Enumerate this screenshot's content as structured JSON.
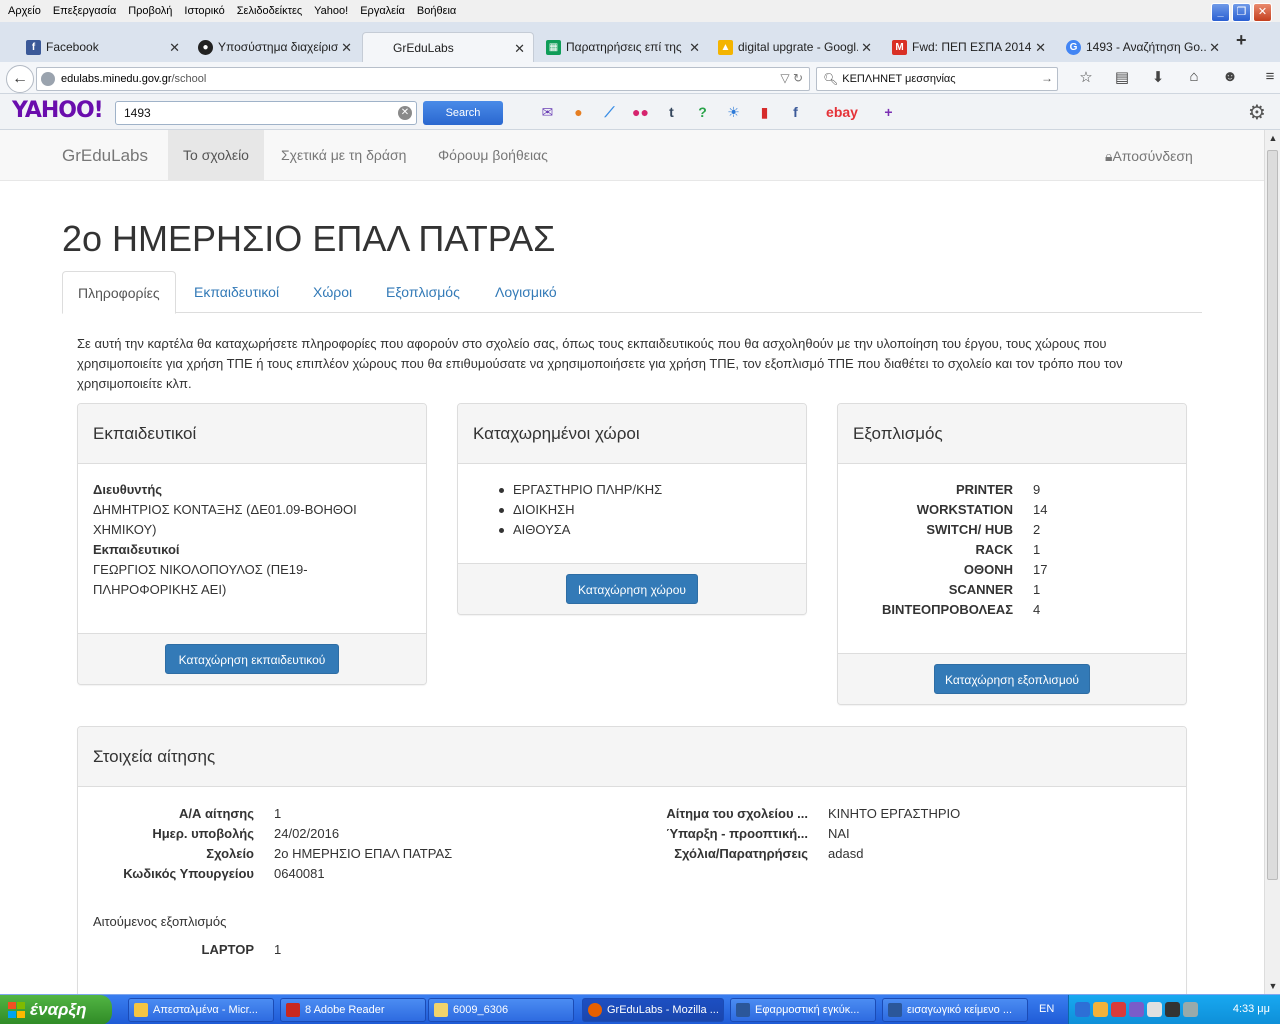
{
  "browser": {
    "menu": [
      "Αρχείο",
      "Επεξεργασία",
      "Προβολή",
      "Ιστορικό",
      "Σελιδοδείκτες",
      "Yahoo!",
      "Εργαλεία",
      "Βοήθεια"
    ],
    "tabs": [
      {
        "title": "Facebook",
        "icon": "facebook-icon",
        "color": "#3b5998"
      },
      {
        "title": "Υποσύστημα διαχείρισ...",
        "icon": "github-icon",
        "color": "#222222"
      },
      {
        "title": "GrEduLabs",
        "icon": "",
        "color": ""
      },
      {
        "title": "Παρατηρήσεις επί της ...",
        "icon": "sheets-icon",
        "color": "#0f9d58"
      },
      {
        "title": "digital upgrate - Googl...",
        "icon": "drive-icon",
        "color": "#f4b400"
      },
      {
        "title": "Fwd: ΠΕΠ ΕΣΠΑ 2014...",
        "icon": "gmail-icon",
        "color": "#d93025"
      },
      {
        "title": "1493 - Αναζήτηση Go...",
        "icon": "google-icon",
        "color": "#4285f4"
      }
    ],
    "url_host": "edulabs.minedu.gov.gr",
    "url_path": "/school",
    "search_value": "ΚΕΠΛΗΝΕΤ μεσσηνίας"
  },
  "yahoo": {
    "logo": "YAHOO!",
    "query": "1493",
    "search_label": "Search",
    "ebay": "ebay"
  },
  "site": {
    "brand": "GrEduLabs",
    "nav": [
      "Το σχολείο",
      "Σχετικά με τη δράση",
      "Φόρουμ βοήθειας"
    ],
    "logout": "Αποσύνδεση",
    "title": "2ο ΗΜΕΡΗΣΙΟ ΕΠΑΛ ΠΑΤΡΑΣ",
    "tabs": [
      "Πληροφορίες",
      "Εκπαιδευτικοί",
      "Χώροι",
      "Εξοπλισμός",
      "Λογισμικό"
    ],
    "intro": "Σε αυτή την καρτέλα θα καταχωρήσετε πληροφορίες που αφορούν στο σχολείο σας, όπως τους εκπαιδευτικούς που θα ασχοληθούν με την υλοποίηση του έργου, τους χώρους που χρησιμοποιείτε για χρήση ΤΠΕ ή τους επιπλέον χώρους που θα επιθυμούσατε να χρησιμοποιήσετε για χρήση ΤΠΕ, τον εξοπλισμό ΤΠΕ που διαθέτει το σχολείο και τον τρόπο που τον χρησιμοποιείτε κλπ."
  },
  "teachers_panel": {
    "title": "Εκπαιδευτικοί",
    "director_label": "Διευθυντής",
    "director": "ΔΗΜΗΤΡΙΟΣ ΚΟΝΤΑΞΗΣ (ΔΕ01.09-ΒΟΗΘΟΙ ΧΗΜΙΚΟΥ)",
    "teachers_label": "Εκπαιδευτικοί",
    "teacher": "ΓΕΩΡΓΙΟΣ ΝΙΚΟΛΟΠΟΥΛΟΣ (ΠΕ19-ΠΛΗΡΟΦΟΡΙΚΗΣ ΑΕΙ)",
    "button": "Καταχώρηση εκπαιδευτικού"
  },
  "spaces_panel": {
    "title": "Καταχωρημένοι χώροι",
    "items": [
      "ΕΡΓΑΣΤΗΡΙΟ ΠΛΗΡ/ΚΗΣ",
      "ΔΙΟΙΚΗΣΗ",
      "ΑΙΘΟΥΣΑ"
    ],
    "button": "Καταχώρηση χώρου"
  },
  "equipment_panel": {
    "title": "Εξοπλισμός",
    "items": [
      {
        "name": "PRINTER",
        "count": "9"
      },
      {
        "name": "WORKSTATION",
        "count": "14"
      },
      {
        "name": "SWITCH/ HUB",
        "count": "2"
      },
      {
        "name": "RACK",
        "count": "1"
      },
      {
        "name": "ΟΘΟΝΗ",
        "count": "17"
      },
      {
        "name": "SCANNER",
        "count": "1"
      },
      {
        "name": "ΒΙΝΤΕΟΠΡΟΒΟΛΕΑΣ",
        "count": "4"
      }
    ],
    "button": "Καταχώρηση εξοπλισμού"
  },
  "application_panel": {
    "title": "Στοιχεία αίτησης",
    "left": [
      {
        "label": "Α/Α αίτησης",
        "value": "1"
      },
      {
        "label": "Ημερ. υποβολής",
        "value": "24/02/2016"
      },
      {
        "label": "Σχολείο",
        "value": "2ο ΗΜΕΡΗΣΙΟ ΕΠΑΛ ΠΑΤΡΑΣ"
      },
      {
        "label": "Κωδικός Υπουργείου",
        "value": "0640081"
      }
    ],
    "right": [
      {
        "label": "Αίτημα του σχολείου ...",
        "value": "ΚΙΝΗΤΟ ΕΡΓΑΣΤΗΡΙΟ"
      },
      {
        "label": "Ύπαρξη - προοπτική...",
        "value": "ΝΑΙ"
      },
      {
        "label": "Σχόλια/Παρατηρήσεις",
        "value": "adasd"
      }
    ],
    "requested_label": "Αιτούμενος εξοπλισμός",
    "requested": [
      {
        "name": "LAPTOP",
        "count": "1"
      }
    ]
  },
  "taskbar": {
    "start": "έναρξη",
    "tasks": [
      "Απεσταλμένα - Micr...",
      "8 Adobe Reader",
      "6009_6306",
      "GrEduLabs - Mozilla ...",
      "Εφαρμοστική εγκύκ...",
      "εισαγωγικό κείμενο ..."
    ],
    "lang": "EN",
    "clock": "4:33 μμ"
  }
}
